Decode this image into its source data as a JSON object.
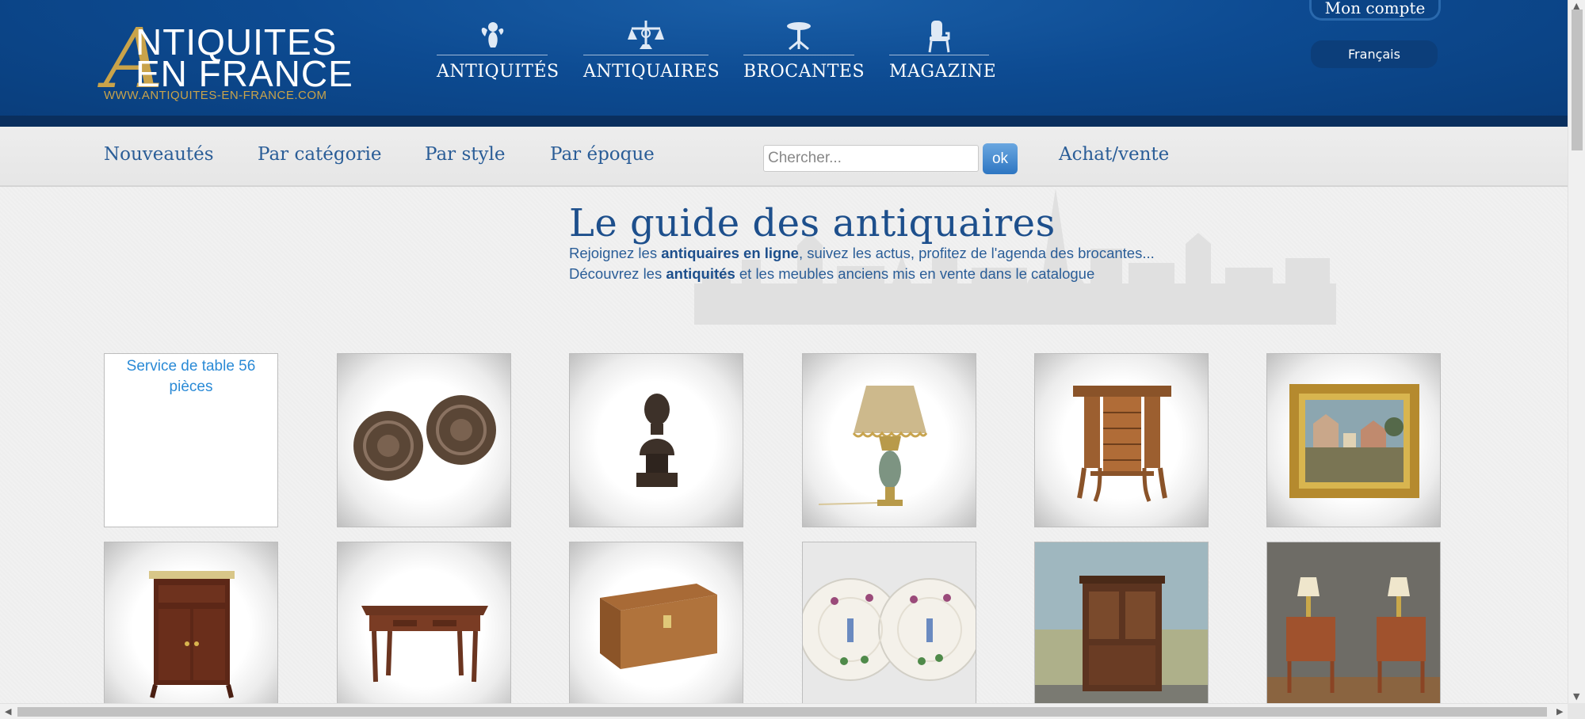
{
  "logo": {
    "letter": "A",
    "line1": "NTIQUITES",
    "line2": "EN FRANCE",
    "url": "WWW.ANTIQUITES-EN-FRANCE.COM"
  },
  "main_nav": [
    {
      "label": "ANTIQUITÉS",
      "icon": "cherub-icon"
    },
    {
      "label": "ANTIQUAIRES",
      "icon": "scale-icon"
    },
    {
      "label": "BROCANTES",
      "icon": "table-icon"
    },
    {
      "label": "MAGAZINE",
      "icon": "chair-icon"
    }
  ],
  "account": {
    "label": "Mon compte"
  },
  "language": {
    "label": "Français"
  },
  "sub_nav": {
    "items": [
      "Nouveautés",
      "Par catégorie",
      "Par style",
      "Par époque"
    ],
    "achat": "Achat/vente"
  },
  "search": {
    "placeholder": "Chercher...",
    "button": "ok"
  },
  "hero": {
    "title": "Le guide des antiquaires",
    "line1_before": "Rejoignez les ",
    "line1_bold": "antiquaires en ligne",
    "line1_after": ", suivez les actus, profitez de l'agenda des brocantes...",
    "line2_before": "Découvrez les ",
    "line2_bold": "antiquités",
    "line2_after": " et les meubles anciens mis en vente dans le catalogue"
  },
  "products": [
    {
      "name": "service-de-table-broken-image",
      "alt": "Service de table 56 pièces"
    },
    {
      "name": "wall-plates-image"
    },
    {
      "name": "bronze-bust-image"
    },
    {
      "name": "table-lamp-image"
    },
    {
      "name": "louis-xv-side-table-image"
    },
    {
      "name": "framed-painting-image"
    },
    {
      "name": "mahogany-cabinet-image"
    },
    {
      "name": "writing-desk-image"
    },
    {
      "name": "wooden-chest-image"
    },
    {
      "name": "faience-plates-image"
    },
    {
      "name": "walnut-cabinet-image"
    },
    {
      "name": "bedside-tables-pair-image"
    }
  ],
  "colors": {
    "header_blue": "#0d4b92",
    "header_dark": "#0a2f5e",
    "gold": "#c9a34a",
    "link_blue": "#2a5d97",
    "title_blue": "#1d4f8c"
  }
}
